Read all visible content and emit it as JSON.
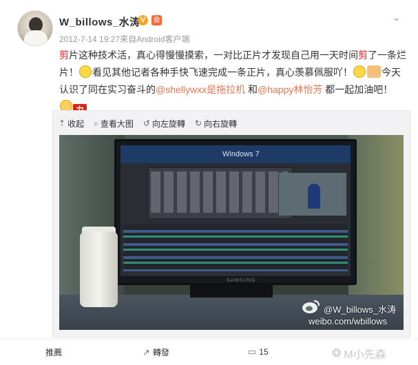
{
  "header": {
    "user_name": "W_billows_水涛",
    "verify_badge": "V",
    "member_icon": "会",
    "menu_icon": "chevron-down-icon",
    "timestamp": "2012-7-14 19:27",
    "source": "来自Android客户端"
  },
  "post": {
    "seg1_red": "剪",
    "seg1": "片这种技术活，真心得慢慢摸索，一对比正片才发现自己用一天时间",
    "seg2_red": "剪",
    "seg2": "了一条烂片！",
    "seg3": "看见其他记者各种手快飞速完成一条正片，真心羡慕佩服吖！",
    "seg4": "今天认识了同在实习奋斗的",
    "mention1": "@shellywxx是拖拉机",
    "seg5": " 和",
    "mention2": "@happy林怡芳",
    "seg6": " 都一起加油吧！",
    "emo_li": "力"
  },
  "media_toolbar": {
    "collapse": "收起",
    "view_large": "查看大图",
    "rotate_left": "向左旋轉",
    "rotate_right": "向右旋轉"
  },
  "photo": {
    "screen_os_label": "Windows 7",
    "monitor_brand": "SAMSUNG",
    "watermark_user": "@W_billows_水涛",
    "watermark_url": "weibo.com/wbillows"
  },
  "actions": {
    "recommend": "推薦",
    "forward": "轉發",
    "comment_count": "15",
    "wechat_mark": "M小先森"
  },
  "colors": {
    "accent_red": "#e02222",
    "mention": "#eb7350",
    "verify_badge": "#f5a623"
  }
}
